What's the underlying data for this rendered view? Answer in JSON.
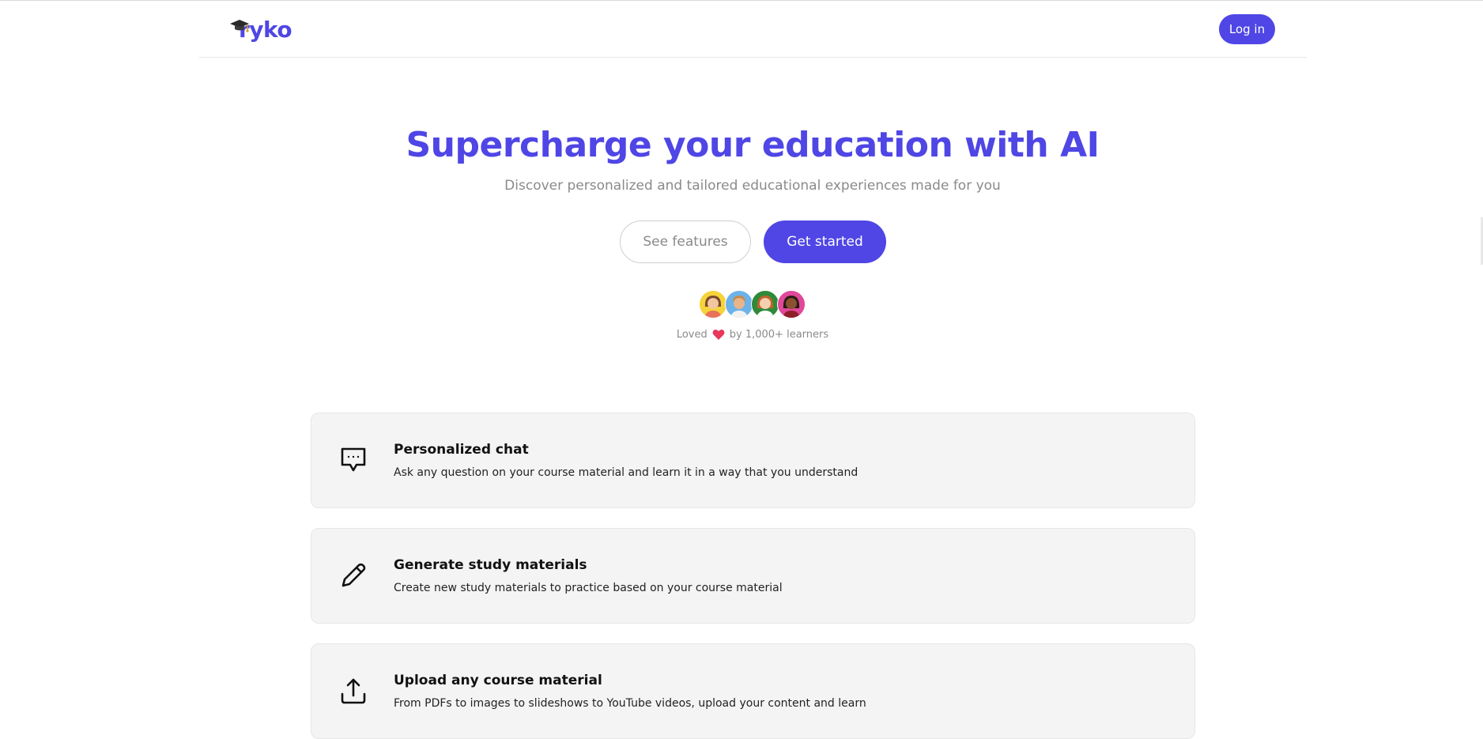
{
  "header": {
    "logo_text": "ryko",
    "login_label": "Log in"
  },
  "hero": {
    "title": "Supercharge your education with AI",
    "subtitle": "Discover personalized and tailored educational experiences made for you",
    "see_features_label": "See features",
    "get_started_label": "Get started",
    "social_proof_prefix": "Loved",
    "social_proof_suffix": "by 1,000+ learners"
  },
  "features": [
    {
      "title": "Personalized chat",
      "description": "Ask any question on your course material and learn it in a way that you understand",
      "icon": "chat-bubble-icon"
    },
    {
      "title": "Generate study materials",
      "description": "Create new study materials to practice based on your course material",
      "icon": "pencil-icon"
    },
    {
      "title": "Upload any course material",
      "description": "From PDFs to images to slideshows to YouTube videos, upload your content and learn",
      "icon": "upload-icon"
    }
  ],
  "colors": {
    "brand": "#4f46e5",
    "muted_text": "#8a8a8a",
    "card_bg": "#f4f4f4",
    "heart": "#e8385c"
  }
}
